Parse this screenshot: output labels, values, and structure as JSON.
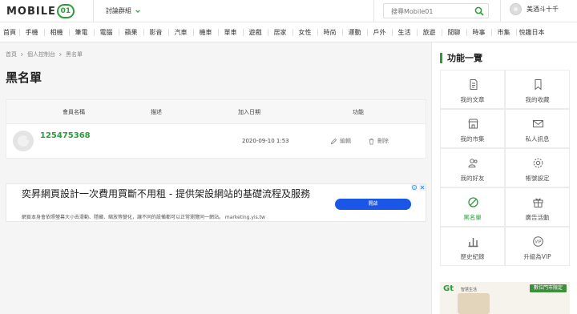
{
  "header": {
    "logo": {
      "text": "MOBILE",
      "badge": "01"
    },
    "forum_group": "討論群組",
    "search": {
      "placeholder": "搜尋Mobile01"
    },
    "user": {
      "name": "美酒斗十千"
    }
  },
  "nav": {
    "items": [
      "首頁",
      "手機",
      "相機",
      "筆電",
      "電腦",
      "蘋果",
      "影音",
      "汽車",
      "機車",
      "單車",
      "遊戲",
      "居家",
      "女性",
      "時尚",
      "運動",
      "戶外",
      "生活",
      "旅遊",
      "閒聊",
      "時事",
      "市集",
      "悅趣日本"
    ]
  },
  "breadcrumb": [
    "首頁",
    "個人控制台",
    "黑名單"
  ],
  "page": {
    "title": "黑名單"
  },
  "blacklist": {
    "columns": {
      "member": "會員名稱",
      "note": "描述",
      "date": "加入日期",
      "action": "功能"
    },
    "rows": [
      {
        "name": "125475368",
        "note": "",
        "date": "2020-09-10 1:53",
        "edit": "編輯",
        "delete": "刪除"
      }
    ]
  },
  "ad": {
    "title": "奕昇網頁設計一次費用買斷不用租 - 提供架設網站的基礎流程及服務",
    "desc": "網頁本身會依照螢幕大小去滑動、隱藏、縮放等變化，讓不同的設備都可以正常瀏覽同一網站。 marketing.yis.tw",
    "button": "開啟"
  },
  "sidebar": {
    "title": "功能一覽",
    "tiles": [
      {
        "label": "我的文章",
        "icon": "document-icon",
        "active": false
      },
      {
        "label": "我的收藏",
        "icon": "bookmark-icon",
        "active": false
      },
      {
        "label": "我的市集",
        "icon": "store-icon",
        "active": false
      },
      {
        "label": "私人訊息",
        "icon": "mail-icon",
        "active": false
      },
      {
        "label": "我的好友",
        "icon": "friends-icon",
        "active": false
      },
      {
        "label": "帳號設定",
        "icon": "gear-icon",
        "active": false
      },
      {
        "label": "黑名單",
        "icon": "block-icon",
        "active": true
      },
      {
        "label": "廣告活動",
        "icon": "gift-icon",
        "active": false
      },
      {
        "label": "歷史紀錄",
        "icon": "bar-chart-icon",
        "active": false
      },
      {
        "label": "升級為VIP",
        "icon": "vip-badge-icon",
        "active": false
      }
    ],
    "promo": {
      "brand": "Gt",
      "sub": "智慧生活",
      "tag": "數位門市限定"
    }
  },
  "colors": {
    "accent": "#2a9d3a",
    "button": "#1a56e8"
  }
}
